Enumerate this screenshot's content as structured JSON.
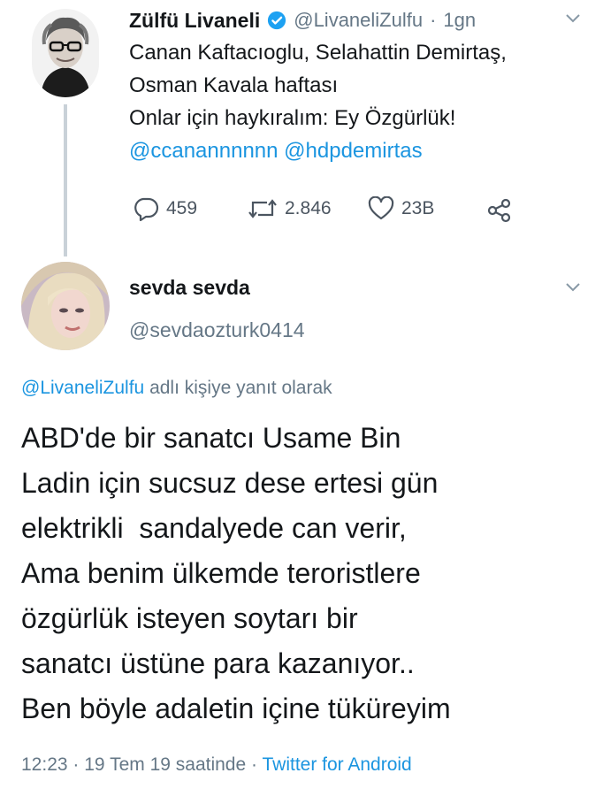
{
  "tweet1": {
    "display_name": "Zülfü Livaneli",
    "handle": "@LivaneliZulfu",
    "separator": "·",
    "time": "1gn",
    "lines": [
      "Canan Kaftacıoglu, Selahattin Demirtaş,",
      "Osman Kavala haftası",
      "Onlar için haykıralım: Ey Özgürlük!"
    ],
    "mentions": [
      "@ccanannnnnn",
      "@hdpdemirtas"
    ],
    "reply_count": "459",
    "retweet_count": "2.846",
    "like_count": "23B"
  },
  "tweet2": {
    "display_name": "sevda sevda",
    "handle": "@sevdaozturk0414",
    "reply_to_handle": "@LivaneliZulfu",
    "reply_to_text": "adlı kişiye yanıt olarak",
    "body_lines": [
      "ABD'de bir sanatcı Usame Bin",
      "Ladin için sucsuz dese ertesi gün",
      "elektrikli  sandalyede can verir,",
      "Ama benim ülkemde teroristlere",
      "özgürlük isteyen soytarı bir",
      "sanatcı üstüne para kazanıyor..",
      "Ben böyle adaletin içine tüküreyim"
    ],
    "time": "12:23",
    "date": "19 Tem 19 saatinde",
    "dot": "·",
    "source": "Twitter for Android"
  },
  "colors": {
    "link": "#1b95e0",
    "muted": "#657786",
    "verified": "#1da1f2",
    "thread_line": "#c9d1d8"
  },
  "icons": [
    "verified-badge-icon",
    "chevron-down-icon",
    "reply-icon",
    "retweet-icon",
    "like-icon",
    "share-icon"
  ]
}
